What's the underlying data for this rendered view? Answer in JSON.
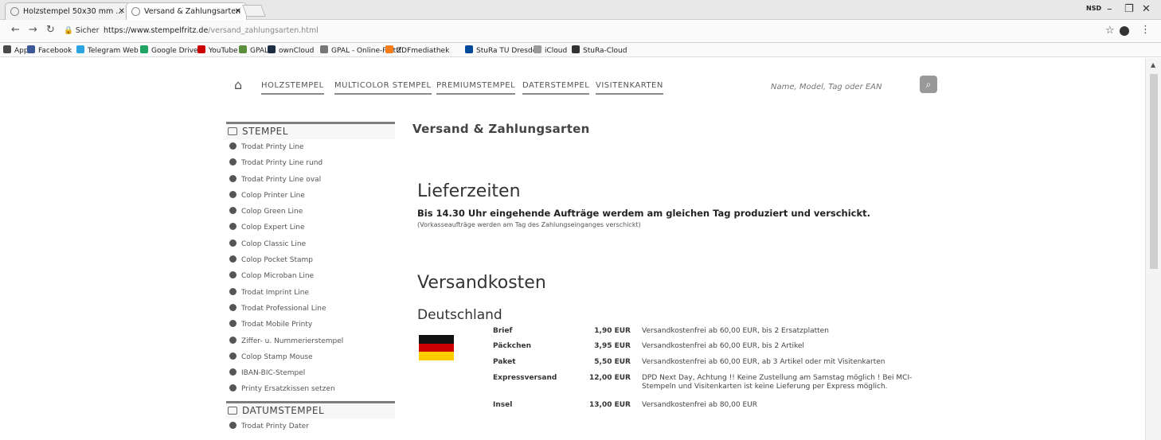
{
  "browser": {
    "tabs": [
      {
        "title": "Holzstempel 50x30 mm ..."
      },
      {
        "title": "Versand & Zahlungsarten"
      }
    ],
    "user_badge": "NSD",
    "secure_label": "Sicher",
    "url_base": "https://www.stempelfritz.de",
    "url_path": "/versand_zahlungsarten.html",
    "bookmarks": [
      {
        "label": "Apps",
        "color": "#4a4a4a"
      },
      {
        "label": "Facebook",
        "color": "#3b5998"
      },
      {
        "label": "Telegram Web",
        "color": "#2ca5e0"
      },
      {
        "label": "Google Drive",
        "color": "#1fa463"
      },
      {
        "label": "YouTube",
        "color": "#cc0000"
      },
      {
        "label": "GPAL",
        "color": "#5a8f3c"
      },
      {
        "label": "ownCloud",
        "color": "#1d2d44"
      },
      {
        "label": "GPAL - Online-Plattf",
        "color": "#777777"
      },
      {
        "label": "ZDFmediathek",
        "color": "#fa7d19"
      },
      {
        "label": "StuRa TU Dresden",
        "color": "#004a99"
      },
      {
        "label": "iCloud",
        "color": "#999999"
      },
      {
        "label": "StuRa-Cloud",
        "color": "#333333"
      }
    ]
  },
  "topnav": {
    "links": [
      "HOLZSTEMPEL",
      "MULTICOLOR STEMPEL",
      "PREMIUMSTEMPEL",
      "DATERSTEMPEL",
      "VISITENKARTEN"
    ],
    "search_placeholder": "Name, Model, Tag oder EAN"
  },
  "sidebar": {
    "heading_stempel": "STEMPEL",
    "items": [
      "Trodat Printy Line",
      "Trodat Printy Line rund",
      "Trodat Printy Line oval",
      "Colop Printer Line",
      "Colop Green Line",
      "Colop Expert Line",
      "Colop Classic Line",
      "Colop Pocket Stamp",
      "Colop Microban Line",
      "Trodat Imprint Line",
      "Trodat Professional Line",
      "Trodat Mobile Printy",
      "Ziffer- u. Nummerierstempel",
      "Colop Stamp Mouse",
      "IBAN-BIC-Stempel",
      "Printy Ersatzkissen setzen"
    ],
    "heading_datum": "DATUMSTEMPEL",
    "datum_items": [
      "Trodat Printy Dater"
    ]
  },
  "content": {
    "page_title": "Versand & Zahlungsarten",
    "lieferzeiten_title": "Lieferzeiten",
    "lieferzeiten_lead": "Bis 14.30 Uhr eingehende Aufträge werdem am gleichen Tag produziert und verschickt.",
    "lieferzeiten_note": "(Vorkasseaufträge werden am Tag des Zahlungseinganges verschickt)",
    "versandkosten_title": "Versandkosten",
    "country": "Deutschland",
    "flag_colors": [
      "#111111",
      "#cc0000",
      "#ffcc00"
    ],
    "rates": [
      {
        "category": "Brief",
        "price": "1,90 EUR",
        "info": "Versandkostenfrei ab 60,00 EUR, bis 2 Ersatzplatten"
      },
      {
        "category": "Päckchen",
        "price": "3,95 EUR",
        "info": "Versandkostenfrei ab 60,00 EUR, bis 2 Artikel"
      },
      {
        "category": "Paket",
        "price": "5,50 EUR",
        "info": "Versandkostenfrei ab 60,00 EUR, ab 3 Artikel oder mit Visitenkarten"
      },
      {
        "category": "Expressversand",
        "price": "12,00 EUR",
        "info": "DPD Next Day, Achtung !! Keine Zustellung am Samstag möglich ! Bei MCI-Stempeln und Visitenkarten ist keine Lieferung per Express möglich."
      },
      {
        "category": "Insel",
        "price": "13,00 EUR",
        "info": "Versandkostenfrei ab 80,00 EUR"
      }
    ]
  }
}
